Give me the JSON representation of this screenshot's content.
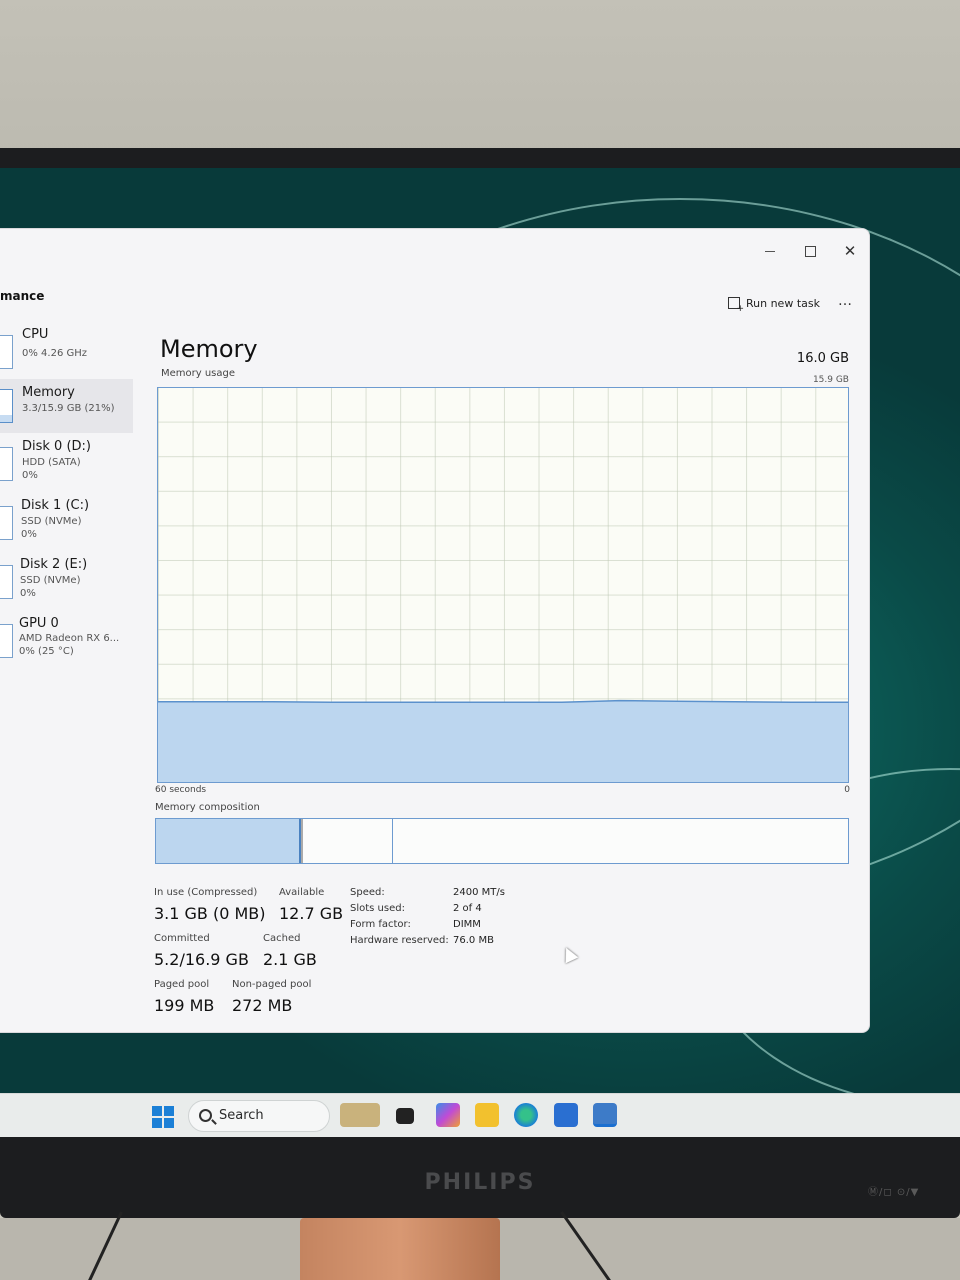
{
  "window": {
    "section_title": "mance",
    "controls": {
      "minimize": "–",
      "maximize": "",
      "close": "✕"
    },
    "run_new_task": "Run new task",
    "more": "…"
  },
  "sidebar": {
    "items": [
      {
        "name": "CPU",
        "line1": "0% 4.26 GHz",
        "line2": "",
        "active": false
      },
      {
        "name": "Memory",
        "line1": "3.3/15.9 GB (21%)",
        "line2": "",
        "active": true
      },
      {
        "name": "Disk 0 (D:)",
        "line1": "HDD (SATA)",
        "line2": "0%",
        "active": false
      },
      {
        "name": "Disk 1 (C:)",
        "line1": "SSD (NVMe)",
        "line2": "0%",
        "active": false
      },
      {
        "name": "Disk 2 (E:)",
        "line1": "SSD (NVMe)",
        "line2": "0%",
        "active": false
      },
      {
        "name": "GPU 0",
        "line1": "AMD Radeon RX 6...",
        "line2": "0% (25 °C)",
        "active": false
      }
    ]
  },
  "memory": {
    "title": "Memory",
    "total": "16.0 GB",
    "usage_label": "Memory usage",
    "max_label": "15.9 GB",
    "axis_left": "60 seconds",
    "axis_right": "0",
    "composition_label": "Memory composition",
    "composition": {
      "in_use_fraction": 0.21,
      "modified_fraction": 0.003,
      "standby_fraction": 0.13
    },
    "stats": {
      "in_use_label": "In use (Compressed)",
      "in_use_value": "3.1 GB (0 MB)",
      "available_label": "Available",
      "available_value": "12.7 GB",
      "committed_label": "Committed",
      "committed_value": "5.2/16.9 GB",
      "cached_label": "Cached",
      "cached_value": "2.1 GB",
      "paged_label": "Paged pool",
      "paged_value": "199 MB",
      "nonpaged_label": "Non-paged pool",
      "nonpaged_value": "272 MB"
    },
    "specs": [
      {
        "label": "Speed:",
        "value": "2400 MT/s"
      },
      {
        "label": "Slots used:",
        "value": "2 of 4"
      },
      {
        "label": "Form factor:",
        "value": "DIMM"
      },
      {
        "label": "Hardware reserved:",
        "value": "76.0 MB"
      }
    ]
  },
  "chart_data": {
    "type": "area",
    "title": "Memory usage",
    "xlabel": "60 seconds",
    "ylabel": "",
    "xlim": [
      60,
      0
    ],
    "ylim": [
      0,
      15.9
    ],
    "x": [
      60,
      55,
      50,
      45,
      40,
      35,
      30,
      25,
      20,
      15,
      10,
      5,
      0
    ],
    "series": [
      {
        "values": [
          3.3,
          3.3,
          3.3,
          3.28,
          3.28,
          3.28,
          3.28,
          3.28,
          3.35,
          3.32,
          3.3,
          3.28,
          3.28
        ]
      }
    ],
    "colors": {
      "fill": "#bcd6ef",
      "line": "#5b91cc"
    }
  },
  "taskbar": {
    "search": "Search",
    "apps": [
      "widgets-icon",
      "terminal-icon",
      "copilot-icon",
      "file-explorer-icon",
      "edge-icon",
      "store-icon",
      "task-manager-icon"
    ]
  },
  "monitor": {
    "brand": "PHILIPS",
    "buttons": "Ⓜ/◻  ⊙/▼"
  }
}
